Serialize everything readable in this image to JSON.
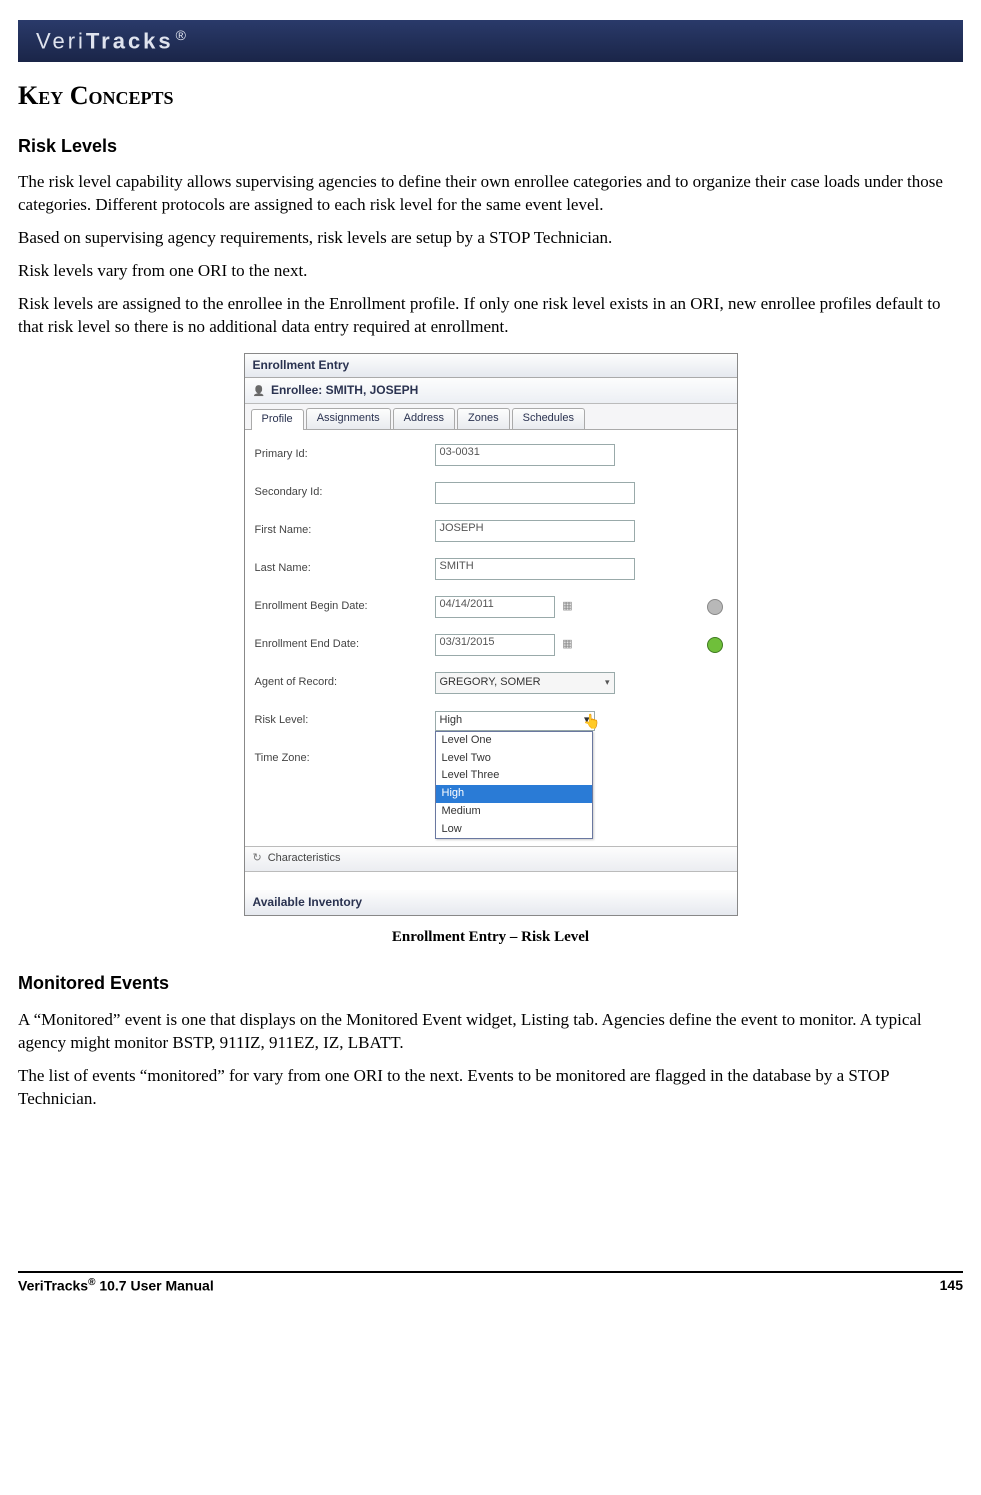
{
  "banner": {
    "brand_a": "Veri",
    "brand_b": "Tracks",
    "reg": "®"
  },
  "h1": "Key Concepts",
  "sections": {
    "risk": {
      "title": "Risk Levels",
      "p1": "The risk level capability allows supervising agencies to define their own enrollee categories and to organize their case loads under those categories.  Different protocols are assigned to each risk level for the same event level.",
      "p2": "Based on supervising agency requirements, risk levels are setup by a STOP Technician.",
      "p3": "Risk levels vary from one ORI to the next.",
      "p4": "Risk levels are assigned to the enrollee in the Enrollment profile.  If only one risk level exists in an ORI, new enrollee profiles default to that risk level so there is no additional data entry required at enrollment."
    },
    "mon": {
      "title": "Monitored Events",
      "p1": "A “Monitored” event is one that displays on the Monitored Event widget, Listing tab.  Agencies define the event to monitor.  A typical agency might monitor BSTP, 911IZ, 911EZ, IZ, LBATT.",
      "p2": "The list of events “monitored” for vary from one ORI to the next.   Events to be monitored are flagged in the database by a STOP Technician."
    }
  },
  "figure": {
    "titlebar": "Enrollment Entry",
    "enrollee_label": "Enrollee: SMITH, JOSEPH",
    "tabs": [
      "Profile",
      "Assignments",
      "Address",
      "Zones",
      "Schedules"
    ],
    "fields": {
      "primary_id": {
        "label": "Primary Id:",
        "value": "03-0031"
      },
      "secondary_id": {
        "label": "Secondary Id:",
        "value": ""
      },
      "first_name": {
        "label": "First Name:",
        "value": "JOSEPH"
      },
      "last_name": {
        "label": "Last Name:",
        "value": "SMITH"
      },
      "begin_date": {
        "label": "Enrollment Begin Date:",
        "value": "04/14/2011"
      },
      "end_date": {
        "label": "Enrollment End Date:",
        "value": "03/31/2015"
      },
      "agent": {
        "label": "Agent of Record:",
        "value": "GREGORY, SOMER"
      },
      "risk": {
        "label": "Risk Level:",
        "value": "High"
      },
      "tz": {
        "label": "Time Zone:",
        "value": ""
      }
    },
    "dropdown": [
      "Level One",
      "Level Two",
      "Level Three",
      "High",
      "Medium",
      "Low"
    ],
    "dropdown_selected": "High",
    "characteristics": "Characteristics",
    "inventory": "Available Inventory",
    "caption": "Enrollment Entry – Risk Level"
  },
  "footer": {
    "left_a": "VeriTracks",
    "left_sup": "®",
    "left_b": " 10.7 User Manual",
    "right": "145"
  }
}
